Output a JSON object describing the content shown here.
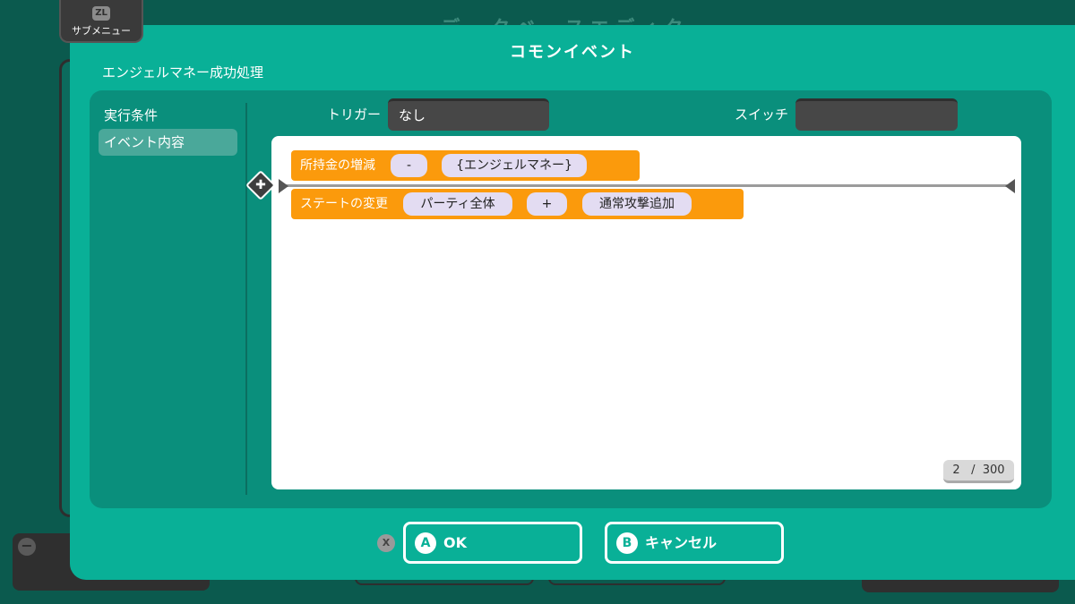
{
  "background": {
    "title": "データベースエディタ"
  },
  "submenu": {
    "key": "ZL",
    "label": "サブメニュー"
  },
  "dialog": {
    "title": "コモンイベント",
    "event_name": "エンジェルマネー成功処理"
  },
  "sidebar": {
    "items": [
      {
        "label": "実行条件",
        "selected": false
      },
      {
        "label": "イベント内容",
        "selected": true
      }
    ]
  },
  "fields": {
    "trigger_label": "トリガー",
    "trigger_value": "なし",
    "switch_label": "スイッチ",
    "switch_value": ""
  },
  "commands": [
    {
      "label": "所持金の増減",
      "params": [
        "-",
        "{エンジェルマネー}"
      ]
    },
    {
      "label": "ステートの変更",
      "params": [
        "パーティ全体",
        "+",
        "通常攻撃追加"
      ]
    }
  ],
  "counter": {
    "current": "2",
    "max": "300"
  },
  "buttons": {
    "x_key": "X",
    "ok_key": "A",
    "ok_label": "OK",
    "cancel_key": "B",
    "cancel_label": "キャンセル"
  },
  "colors": {
    "dialog": "#09b097",
    "inner_panel": "#0a8f7c",
    "command": "#fb9a0c",
    "chip": "#e3dcf2"
  }
}
